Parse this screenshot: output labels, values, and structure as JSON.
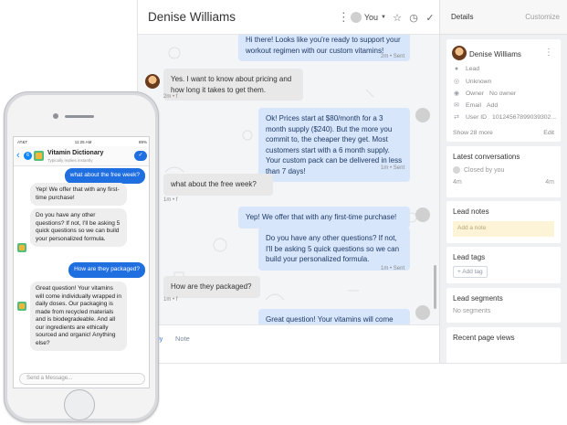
{
  "conversation": {
    "contact_name": "Denise Williams",
    "assignee_label": "You",
    "messages": [
      {
        "text": "Hi there! Looks like you're ready to support your workout regimen with our custom vitamins!",
        "meta": "2m • Sent"
      },
      {
        "text": "Yes. I want to know about pricing and how long it takes to get them.",
        "meta": "2m • f"
      },
      {
        "text": "Ok! Prices start at $80/month for a 3 month supply ($240). But the more you commit to, the cheaper they get. Most customers start with a 6 month supply. Your custom pack can be delivered in less than 7 days!",
        "meta": "1m • Sent"
      },
      {
        "text": "what about the free week?",
        "meta": "1m • f"
      },
      {
        "text": "Yep! We offer that with any first-time purchase!",
        "meta": ""
      },
      {
        "text": "Do you have any other questions? If not, I'll be asking 5 quick questions so we can build your personalized formula.",
        "meta": "1m • Sent"
      },
      {
        "text": "How are they packaged?",
        "meta": "1m • f"
      },
      {
        "text": "Great question! Your vitamins will come individually wrapped in daily doses. Our",
        "meta": ""
      }
    ],
    "composer_tabs": [
      "ly",
      "Note"
    ]
  },
  "sidebar": {
    "title": "Details",
    "customize_label": "Customize",
    "lead": {
      "name": "Denise Williams",
      "type": "Lead",
      "location": "Unknown",
      "owner_label": "Owner",
      "owner_value": "No owner",
      "email_label": "Email",
      "email_value": "Add",
      "user_id_label": "User ID",
      "user_id_value": "10124567899039302...",
      "show_more": "Show 28 more",
      "edit": "Edit"
    },
    "latest_conversations": {
      "title": "Latest conversations",
      "item_status": "Closed by you",
      "item_time_left": "4m",
      "item_time_right": "4m"
    },
    "lead_notes": {
      "title": "Lead notes",
      "placeholder": "Add a note"
    },
    "lead_tags": {
      "title": "Lead tags",
      "button": "+ Add tag"
    },
    "lead_segments": {
      "title": "Lead segments",
      "value": "No segments"
    },
    "recent_page_views": {
      "title": "Recent page views"
    }
  },
  "phone": {
    "status": {
      "carrier": "AT&T",
      "time": "11:25 AM",
      "battery": "89%"
    },
    "back_count": "6",
    "app_name": "Vitamin Dictionary",
    "app_subtitle": "Typically replies instantly",
    "messages": [
      {
        "text": "what about the free week?",
        "from": "user"
      },
      {
        "text": "Yep! We offer that with any first-time purchase!",
        "from": "bot"
      },
      {
        "text": "Do you have any other questions? If not, I'll be asking 5 quick questions so we can build your personalized formula.",
        "from": "bot"
      },
      {
        "text": "How are they packaged?",
        "from": "user"
      },
      {
        "text": "Great question! Your vitamins will come individually wrapped in daily doses. Our packaging is made from recycled materials and is biodegradeable. And all our ingredients are ethically sourced and organic! Anything else?",
        "from": "bot"
      }
    ],
    "input_placeholder": "Send a Message..."
  },
  "colors": {
    "outgoing_bubble": "#d8e6fb",
    "incoming_bubble": "#e8e8e8",
    "phone_user_bubble": "#1f6fe0",
    "accent": "#0a84ff",
    "note_yellow": "#fdf4d8"
  },
  "icons": [
    "kebab-icon",
    "chevron-down-icon",
    "star-icon",
    "clock-icon",
    "check-icon",
    "person-icon",
    "location-icon",
    "owner-icon",
    "email-icon",
    "user-id-icon",
    "wifi-icon",
    "bluetooth-icon"
  ]
}
